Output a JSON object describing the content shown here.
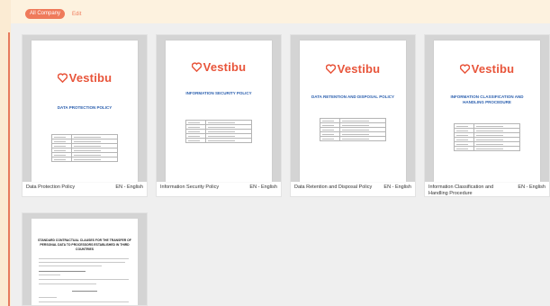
{
  "toolbar": {
    "filter_label": "All Company",
    "edit_label": "Edit"
  },
  "brand": {
    "name": "Vestibu",
    "color": "#e8553b",
    "icon": "heart-logo-icon"
  },
  "documents": [
    {
      "title": "Data Protection Policy",
      "language": "EN - English",
      "cover_title": "DATA PROTECTION POLICY"
    },
    {
      "title": "Information Security Policy",
      "language": "EN - English",
      "cover_title": "INFORMATION SECURITY POLICY"
    },
    {
      "title": "Data Retention and Disposal Policy",
      "language": "EN - English",
      "cover_title": "DATA RETENTION AND DISPOSAL POLICY"
    },
    {
      "title": "Information Classification and Handling Procedure",
      "language": "EN - English",
      "cover_title": "INFORMATION CLASSIFICATION AND HANDLING PROCEDURE"
    }
  ],
  "document5": {
    "cover_title": "STANDARD CONTRACTUAL CLAUSES FOR THE TRANSFER OF PERSONAL DATA TO PROCESSORS ESTABLISHED IN THIRD COUNTRIES"
  },
  "colors": {
    "accent": "#ef7a5b",
    "cover_title": "#2b5fae",
    "background": "#efefef",
    "banner": "#fdf2df"
  }
}
